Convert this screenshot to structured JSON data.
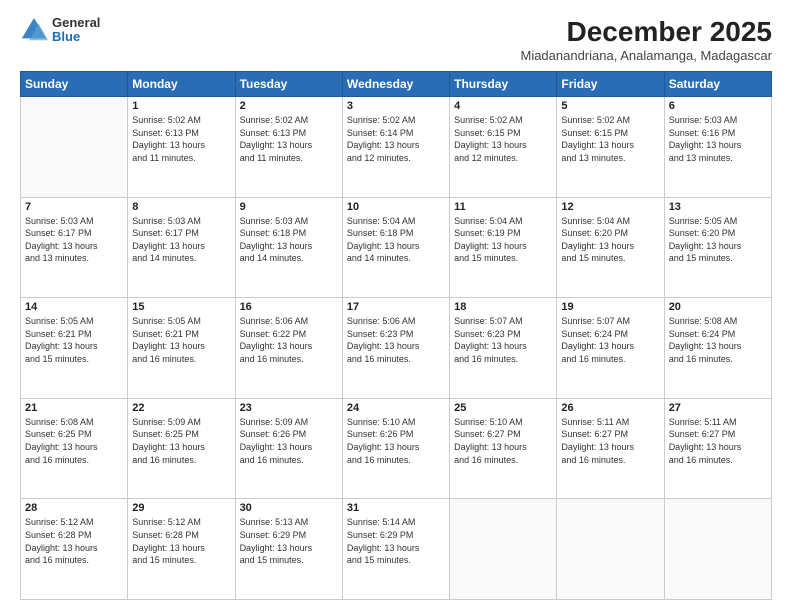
{
  "header": {
    "logo_general": "General",
    "logo_blue": "Blue",
    "month_title": "December 2025",
    "location": "Miadanandriana, Analamanga, Madagascar"
  },
  "days_of_week": [
    "Sunday",
    "Monday",
    "Tuesday",
    "Wednesday",
    "Thursday",
    "Friday",
    "Saturday"
  ],
  "weeks": [
    [
      {
        "day": "",
        "info": ""
      },
      {
        "day": "1",
        "info": "Sunrise: 5:02 AM\nSunset: 6:13 PM\nDaylight: 13 hours\nand 11 minutes."
      },
      {
        "day": "2",
        "info": "Sunrise: 5:02 AM\nSunset: 6:13 PM\nDaylight: 13 hours\nand 11 minutes."
      },
      {
        "day": "3",
        "info": "Sunrise: 5:02 AM\nSunset: 6:14 PM\nDaylight: 13 hours\nand 12 minutes."
      },
      {
        "day": "4",
        "info": "Sunrise: 5:02 AM\nSunset: 6:15 PM\nDaylight: 13 hours\nand 12 minutes."
      },
      {
        "day": "5",
        "info": "Sunrise: 5:02 AM\nSunset: 6:15 PM\nDaylight: 13 hours\nand 13 minutes."
      },
      {
        "day": "6",
        "info": "Sunrise: 5:03 AM\nSunset: 6:16 PM\nDaylight: 13 hours\nand 13 minutes."
      }
    ],
    [
      {
        "day": "7",
        "info": "Sunrise: 5:03 AM\nSunset: 6:17 PM\nDaylight: 13 hours\nand 13 minutes."
      },
      {
        "day": "8",
        "info": "Sunrise: 5:03 AM\nSunset: 6:17 PM\nDaylight: 13 hours\nand 14 minutes."
      },
      {
        "day": "9",
        "info": "Sunrise: 5:03 AM\nSunset: 6:18 PM\nDaylight: 13 hours\nand 14 minutes."
      },
      {
        "day": "10",
        "info": "Sunrise: 5:04 AM\nSunset: 6:18 PM\nDaylight: 13 hours\nand 14 minutes."
      },
      {
        "day": "11",
        "info": "Sunrise: 5:04 AM\nSunset: 6:19 PM\nDaylight: 13 hours\nand 15 minutes."
      },
      {
        "day": "12",
        "info": "Sunrise: 5:04 AM\nSunset: 6:20 PM\nDaylight: 13 hours\nand 15 minutes."
      },
      {
        "day": "13",
        "info": "Sunrise: 5:05 AM\nSunset: 6:20 PM\nDaylight: 13 hours\nand 15 minutes."
      }
    ],
    [
      {
        "day": "14",
        "info": "Sunrise: 5:05 AM\nSunset: 6:21 PM\nDaylight: 13 hours\nand 15 minutes."
      },
      {
        "day": "15",
        "info": "Sunrise: 5:05 AM\nSunset: 6:21 PM\nDaylight: 13 hours\nand 16 minutes."
      },
      {
        "day": "16",
        "info": "Sunrise: 5:06 AM\nSunset: 6:22 PM\nDaylight: 13 hours\nand 16 minutes."
      },
      {
        "day": "17",
        "info": "Sunrise: 5:06 AM\nSunset: 6:23 PM\nDaylight: 13 hours\nand 16 minutes."
      },
      {
        "day": "18",
        "info": "Sunrise: 5:07 AM\nSunset: 6:23 PM\nDaylight: 13 hours\nand 16 minutes."
      },
      {
        "day": "19",
        "info": "Sunrise: 5:07 AM\nSunset: 6:24 PM\nDaylight: 13 hours\nand 16 minutes."
      },
      {
        "day": "20",
        "info": "Sunrise: 5:08 AM\nSunset: 6:24 PM\nDaylight: 13 hours\nand 16 minutes."
      }
    ],
    [
      {
        "day": "21",
        "info": "Sunrise: 5:08 AM\nSunset: 6:25 PM\nDaylight: 13 hours\nand 16 minutes."
      },
      {
        "day": "22",
        "info": "Sunrise: 5:09 AM\nSunset: 6:25 PM\nDaylight: 13 hours\nand 16 minutes."
      },
      {
        "day": "23",
        "info": "Sunrise: 5:09 AM\nSunset: 6:26 PM\nDaylight: 13 hours\nand 16 minutes."
      },
      {
        "day": "24",
        "info": "Sunrise: 5:10 AM\nSunset: 6:26 PM\nDaylight: 13 hours\nand 16 minutes."
      },
      {
        "day": "25",
        "info": "Sunrise: 5:10 AM\nSunset: 6:27 PM\nDaylight: 13 hours\nand 16 minutes."
      },
      {
        "day": "26",
        "info": "Sunrise: 5:11 AM\nSunset: 6:27 PM\nDaylight: 13 hours\nand 16 minutes."
      },
      {
        "day": "27",
        "info": "Sunrise: 5:11 AM\nSunset: 6:27 PM\nDaylight: 13 hours\nand 16 minutes."
      }
    ],
    [
      {
        "day": "28",
        "info": "Sunrise: 5:12 AM\nSunset: 6:28 PM\nDaylight: 13 hours\nand 16 minutes."
      },
      {
        "day": "29",
        "info": "Sunrise: 5:12 AM\nSunset: 6:28 PM\nDaylight: 13 hours\nand 15 minutes."
      },
      {
        "day": "30",
        "info": "Sunrise: 5:13 AM\nSunset: 6:29 PM\nDaylight: 13 hours\nand 15 minutes."
      },
      {
        "day": "31",
        "info": "Sunrise: 5:14 AM\nSunset: 6:29 PM\nDaylight: 13 hours\nand 15 minutes."
      },
      {
        "day": "",
        "info": ""
      },
      {
        "day": "",
        "info": ""
      },
      {
        "day": "",
        "info": ""
      }
    ]
  ]
}
